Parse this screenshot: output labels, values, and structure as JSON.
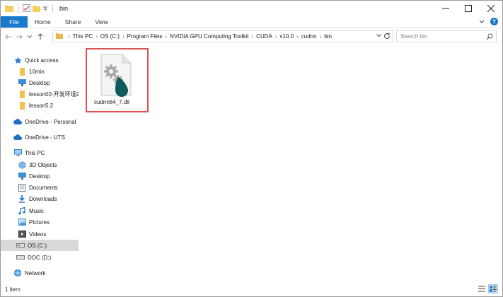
{
  "window": {
    "title": "bin"
  },
  "ribbon": {
    "tabs": [
      "File",
      "Home",
      "Share",
      "View"
    ]
  },
  "address": {
    "breadcrumbs": [
      "This PC",
      "OS (C:)",
      "Program Files",
      "NVIDIA GPU Computing Toolkit",
      "CUDA",
      "v10.0",
      "cudnn",
      "bin"
    ]
  },
  "search": {
    "placeholder": "Search bin"
  },
  "navpane": {
    "items": [
      {
        "label": "Quick access",
        "icon": "star-icon"
      },
      {
        "label": "10min",
        "icon": "folder-icon"
      },
      {
        "label": "Desktop",
        "icon": "desktop-folder-icon"
      },
      {
        "label": "lesson02-开发环境2",
        "icon": "folder-icon"
      },
      {
        "label": "lesson5.2",
        "icon": "folder-icon"
      },
      {
        "label": "OneDrive - Personal",
        "icon": "cloud-icon"
      },
      {
        "label": "OneDrive - UTS",
        "icon": "cloud-icon"
      },
      {
        "label": "This PC",
        "icon": "computer-icon"
      },
      {
        "label": "3D Objects",
        "icon": "cube-folder-icon"
      },
      {
        "label": "Desktop",
        "icon": "desktop-folder-icon"
      },
      {
        "label": "Documents",
        "icon": "documents-folder-icon"
      },
      {
        "label": "Downloads",
        "icon": "downloads-folder-icon"
      },
      {
        "label": "Music",
        "icon": "music-folder-icon"
      },
      {
        "label": "Pictures",
        "icon": "pictures-folder-icon"
      },
      {
        "label": "Videos",
        "icon": "videos-folder-icon"
      },
      {
        "label": "OS (C:)",
        "icon": "drive-icon",
        "selected": true
      },
      {
        "label": "DOC (D:)",
        "icon": "drive-icon"
      },
      {
        "label": "Network",
        "icon": "network-icon"
      }
    ]
  },
  "content": {
    "files": [
      {
        "name": "cudnn64_7.dll",
        "icon": "dll-file-icon",
        "selected": true
      }
    ]
  },
  "status": {
    "item_count": "1 item"
  },
  "colors": {
    "accent": "#1979ca",
    "selection_border": "#d9534f",
    "nav_selected": "#d9d9d9"
  }
}
